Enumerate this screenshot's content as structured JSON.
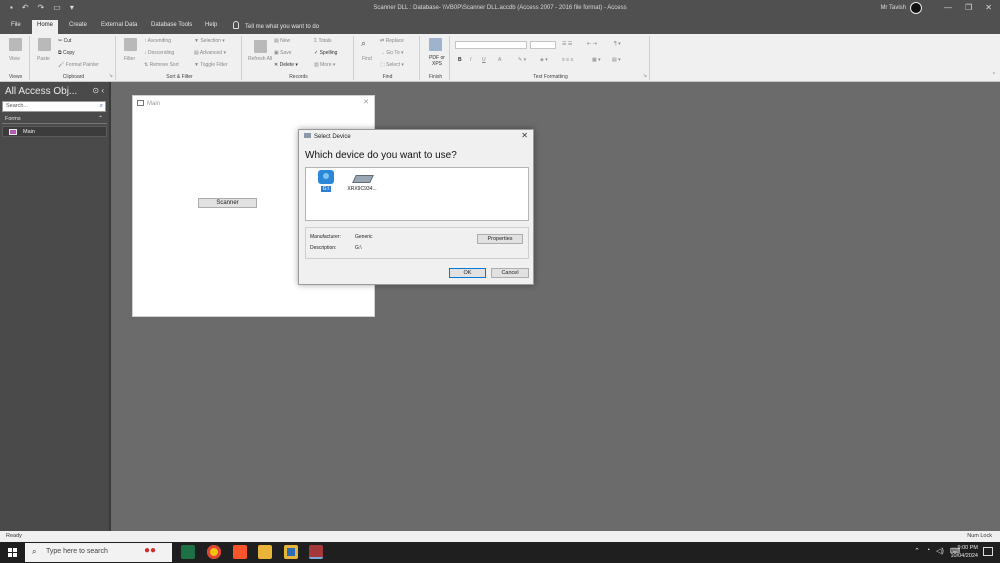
{
  "titlebar": {
    "title": "Scanner DLL : Database- \\\\VB0P\\Scanner DLL.accdb (Access 2007 - 2016 file format) - Access",
    "user": "Mr Tavish",
    "min": "—",
    "restore": "❐",
    "close": "✕"
  },
  "ribbon_tabs": [
    "File",
    "Home",
    "Create",
    "External Data",
    "Database Tools",
    "Help"
  ],
  "tell_me": "Tell me what you want to do",
  "ribbon": {
    "views": {
      "view": "View",
      "label": "Views"
    },
    "clipboard": {
      "paste": "Paste",
      "cut": "Cut",
      "copy": "Copy",
      "format_painter": "Format Painter",
      "label": "Clipboard"
    },
    "sort_filter": {
      "filter": "Filter",
      "ascending": "Ascending",
      "descending": "Descending",
      "remove_sort": "Remove Sort",
      "selection": "Selection",
      "advanced": "Advanced",
      "toggle_filter": "Toggle Filter",
      "label": "Sort & Filter"
    },
    "records": {
      "refresh": "Refresh All",
      "new": "New",
      "save": "Save",
      "delete": "Delete",
      "totals": "Totals",
      "spelling": "Spelling",
      "more": "More",
      "label": "Records"
    },
    "find": {
      "find": "Find",
      "replace": "Replace",
      "go_to": "Go To",
      "select": "Select",
      "label": "Find"
    },
    "finish": {
      "pdf": "PDF or XPS",
      "label": "Finish"
    },
    "text_formatting": {
      "bold": "B",
      "italic": "I",
      "underline": "U",
      "font_color": "A",
      "label": "Text Formatting"
    }
  },
  "nav": {
    "title": "All Access Obj...",
    "search_placeholder": "Search...",
    "section": "Forms",
    "items": [
      "Main"
    ]
  },
  "main_form": {
    "title": "Main",
    "scanner_button": "Scanner"
  },
  "dialog": {
    "title": "Select Device",
    "question": "Which device do you want to use?",
    "devices": [
      {
        "label": "G:\\",
        "icon": "camera-icon",
        "selected": true
      },
      {
        "label": "XRX9C934...",
        "icon": "scanner-icon",
        "selected": false
      }
    ],
    "manufacturer_label": "Manufacturer:",
    "manufacturer_value": "Generic",
    "description_label": "Description:",
    "description_value": "G:\\",
    "properties_button": "Properties",
    "ok_button": "OK",
    "cancel_button": "Cancel"
  },
  "statusbar": {
    "left": "Ready",
    "right": "Num Lock"
  },
  "taskbar": {
    "search_placeholder": "Type here to search",
    "time": "9:00 PM",
    "date": "10/04/2024"
  },
  "colors": {
    "accent": "#2d7fd6",
    "access_red": "#a4373a",
    "excel_green": "#1e7145"
  }
}
